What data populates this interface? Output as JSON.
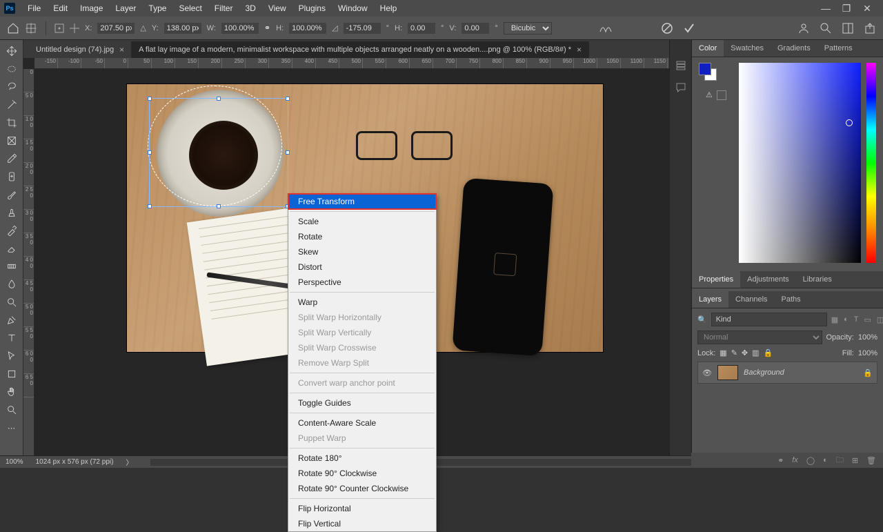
{
  "menubar": [
    "File",
    "Edit",
    "Image",
    "Layer",
    "Type",
    "Select",
    "Filter",
    "3D",
    "View",
    "Plugins",
    "Window",
    "Help"
  ],
  "options": {
    "x_label": "X:",
    "x": "207.50 px",
    "y_label": "Y:",
    "y": "138.00 px",
    "w_label": "W:",
    "w": "100.00%",
    "h_label": "H:",
    "h": "100.00%",
    "angle": "-175.09",
    "h2_label": "H:",
    "h2": "0.00",
    "v_label": "V:",
    "v": "0.00",
    "interp": "Bicubic"
  },
  "tabs": {
    "t1": "Untitled design (74).jpg",
    "t2": "A flat lay image of a modern, minimalist workspace with multiple objects arranged neatly on a wooden....png @ 100% (RGB/8#) *"
  },
  "ruler_h": [
    "-150",
    "-100",
    "-50",
    "0",
    "50",
    "100",
    "150",
    "200",
    "250",
    "300",
    "350",
    "400",
    "450",
    "500",
    "550",
    "600",
    "650",
    "700",
    "750",
    "800",
    "850",
    "900",
    "950",
    "1000",
    "1050",
    "1100",
    "1150"
  ],
  "ruler_v": [
    "0",
    "5 0",
    "1 0 0",
    "1 5 0",
    "2 0 0",
    "2 5 0",
    "3 0 0",
    "3 5 0",
    "4 0 0",
    "4 5 0",
    "5 0 0",
    "5 5 0",
    "6 0 0",
    "6 5 0"
  ],
  "context_menu": {
    "groups": [
      [
        "Free Transform"
      ],
      [
        "Scale",
        "Rotate",
        "Skew",
        "Distort",
        "Perspective"
      ],
      [
        "Warp",
        "Split Warp Horizontally",
        "Split Warp Vertically",
        "Split Warp Crosswise",
        "Remove Warp Split"
      ],
      [
        "Convert warp anchor point"
      ],
      [
        "Toggle Guides"
      ],
      [
        "Content-Aware Scale",
        "Puppet Warp"
      ],
      [
        "Rotate 180°",
        "Rotate 90° Clockwise",
        "Rotate 90° Counter Clockwise"
      ],
      [
        "Flip Horizontal",
        "Flip Vertical"
      ]
    ],
    "highlighted": "Free Transform",
    "disabled": [
      "Split Warp Horizontally",
      "Split Warp Vertically",
      "Split Warp Crosswise",
      "Remove Warp Split",
      "Convert warp anchor point",
      "Puppet Warp"
    ]
  },
  "color_tabs": [
    "Color",
    "Swatches",
    "Gradients",
    "Patterns"
  ],
  "prop_tabs": [
    "Properties",
    "Adjustments",
    "Libraries"
  ],
  "layer_tabs": [
    "Layers",
    "Channels",
    "Paths"
  ],
  "layers": {
    "search_placeholder": "Kind",
    "blend": "Normal",
    "opacity_label": "Opacity:",
    "opacity": "100%",
    "lock_label": "Lock:",
    "fill_label": "Fill:",
    "fill": "100%",
    "bg_name": "Background"
  },
  "status": {
    "zoom": "100%",
    "dims": "1024 px x 576 px (72 ppi)"
  }
}
